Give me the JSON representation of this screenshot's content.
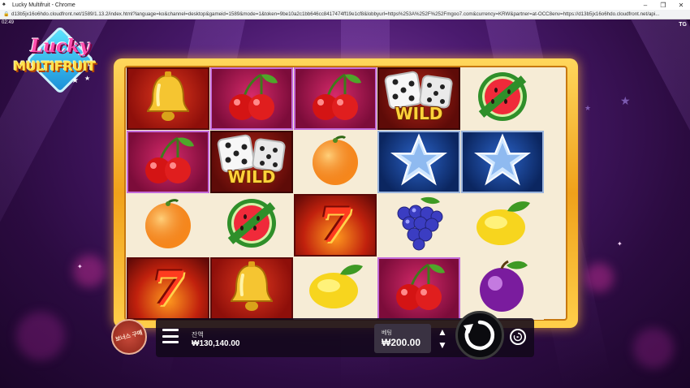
{
  "window": {
    "title": "Lucky Multifruit - Chrome",
    "url": "d13b5jx16o6hdo.cloudfront.net/1589/1.13.2/index.html?language=ko&channel=desktop&gameid=1589&mode=1&token=9be10a2c1bb646cc8417474ff19e1cf8&lobbyurl=https%253A%252F%252Fmgoo7.com&currency=KRW&partner=at-OCC8env=https://d13b5jx16o6hdo.cloudfront.net/api..."
  },
  "hud": {
    "clock": "02:49",
    "tg": "TG"
  },
  "logo": {
    "line1": "Lucky",
    "line2": "MULTIFRUIT"
  },
  "reels": [
    [
      {
        "symbol": "bell",
        "bg": "red"
      },
      {
        "symbol": "cherry",
        "bg": "pink"
      },
      {
        "symbol": "orange",
        "bg": "plain"
      },
      {
        "symbol": "seven",
        "bg": "fire"
      }
    ],
    [
      {
        "symbol": "cherry",
        "bg": "pink"
      },
      {
        "symbol": "wild",
        "bg": "wild"
      },
      {
        "symbol": "watermelon",
        "bg": "plain"
      },
      {
        "symbol": "bell",
        "bg": "red"
      }
    ],
    [
      {
        "symbol": "cherry",
        "bg": "pink"
      },
      {
        "symbol": "orange",
        "bg": "plain"
      },
      {
        "symbol": "seven",
        "bg": "fire"
      },
      {
        "symbol": "lemon",
        "bg": "plain"
      }
    ],
    [
      {
        "symbol": "wild",
        "bg": "wild"
      },
      {
        "symbol": "star",
        "bg": "blue"
      },
      {
        "symbol": "grapes",
        "bg": "plain"
      },
      {
        "symbol": "cherry",
        "bg": "pink"
      }
    ],
    [
      {
        "symbol": "watermelon",
        "bg": "plain"
      },
      {
        "symbol": "star",
        "bg": "blue"
      },
      {
        "symbol": "lemon",
        "bg": "plain"
      },
      {
        "symbol": "plum",
        "bg": "plain"
      }
    ]
  ],
  "wild_label": "WILD",
  "seven_label": "7",
  "controls": {
    "bonus_label": "보너스 구매",
    "balance_label": "잔액",
    "balance_value": "₩130,140.00",
    "bet_label": "베팅",
    "bet_value": "₩200.00",
    "bet_up": "▲",
    "bet_down": "▼"
  }
}
